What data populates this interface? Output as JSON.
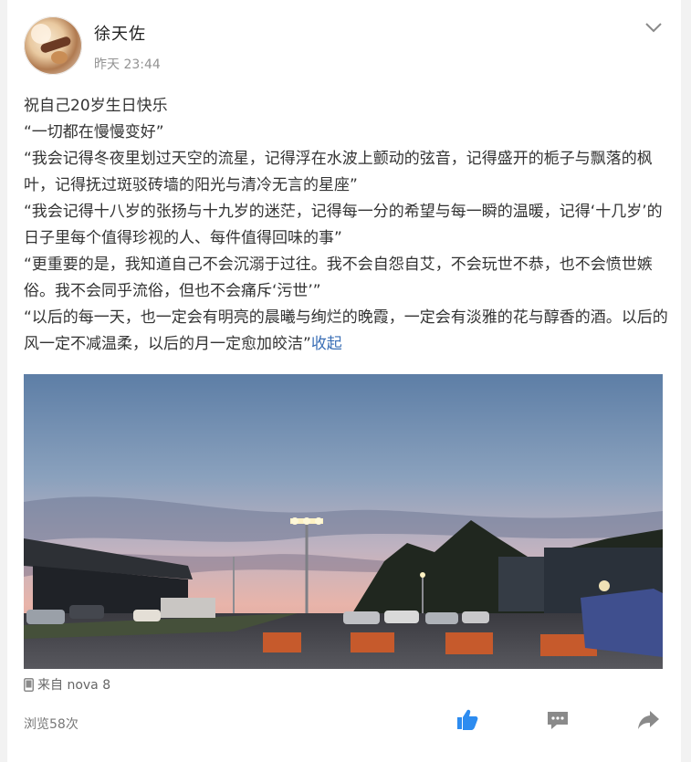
{
  "post": {
    "author": "徐天佐",
    "time": "昨天 23:44",
    "lines": [
      "祝自己20岁生日快乐",
      "“一切都在慢慢变好”",
      "“我会记得冬夜里划过天空的流星，记得浮在水波上颤动的弦音，记得盛开的栀子与飘落的枫叶，记得抚过斑驳砖墙的阳光与清冷无言的星座”",
      "“我会记得十八岁的张扬与十九岁的迷茫，记得每一分的希望与每一瞬的温暖，记得‘十几岁’的日子里每个值得珍视的人、每件值得回味的事”",
      "“更重要的是，我知道自己不会沉溺于过往。我不会自怨自艾，不会玩世不恭，也不会愤世嫉俗。我不会同乎流俗，但也不会痛斥‘污世’”",
      "“以后的每一天，也一定会有明亮的晨曦与绚烂的晚霞，一定会有淡雅的花与醇香的酒。以后的风一定不减温柔，以后的月一定愈加皎洁”"
    ],
    "collapse_label": "收起",
    "source": "来自 nova 8",
    "views": "浏览58次"
  },
  "icons": {
    "chevron": "chevron-down-icon",
    "device": "phone-icon",
    "like": "thumbs-up-icon",
    "comment": "comment-icon",
    "share": "share-icon"
  },
  "colors": {
    "link": "#3b6fb6",
    "like_active": "#2d8cf0",
    "icon_gray": "#888888"
  }
}
